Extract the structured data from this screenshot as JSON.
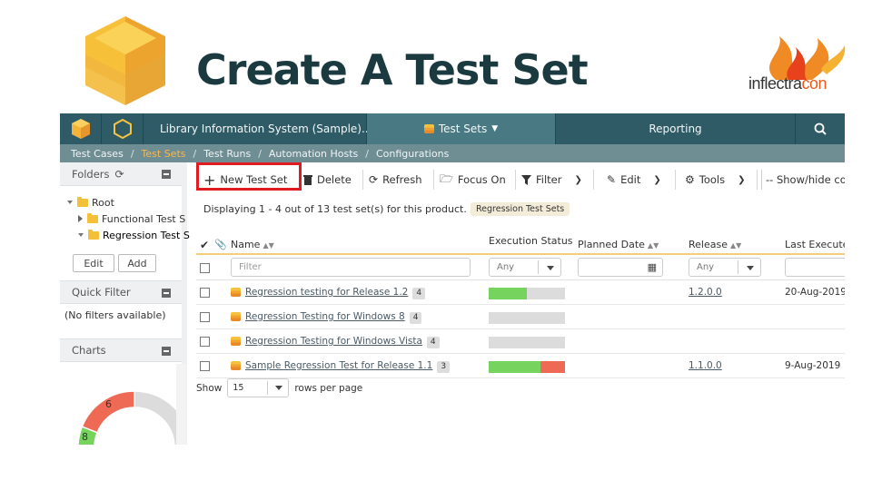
{
  "slide": {
    "title": "Create A Test Set",
    "brand_prefix": "inflectra",
    "brand_suffix": "con"
  },
  "topbar": {
    "project": "Library Information System (Sample)...",
    "artifact": "Test Sets",
    "reporting": "Reporting",
    "search_icon": "search-icon"
  },
  "subnav": {
    "items": [
      "Test Cases",
      "Test Sets",
      "Test Runs",
      "Automation Hosts",
      "Configurations"
    ],
    "active": "Test Sets"
  },
  "sidebar": {
    "folders_title": "Folders",
    "tree": {
      "root": "Root",
      "child1": "Functional Test S",
      "child2": "Regression Test S"
    },
    "edit_label": "Edit",
    "add_label": "Add",
    "quick_filter_title": "Quick Filter",
    "quick_filter_text": "(No filters available)",
    "charts_title": "Charts",
    "chart_data": {
      "type": "pie",
      "values": [
        6,
        8
      ],
      "labels": [
        "6",
        "8"
      ],
      "colors": [
        "#ef6a55",
        "#76d35e"
      ],
      "remainder_color": "#dcdcdc"
    }
  },
  "toolbar": {
    "new_label": "New Test Set",
    "delete_label": "Delete",
    "refresh_label": "Refresh",
    "focus_label": "Focus On",
    "filter_label": "Filter",
    "edit_label": "Edit",
    "tools_label": "Tools",
    "showhide_label": "-- Show/hide co"
  },
  "info": {
    "text": "Displaying 1 - 4 out of 13 test set(s) for this product.",
    "view_badge": "Regression Test Sets"
  },
  "grid": {
    "columns": {
      "name": "Name",
      "status": "Execution Status",
      "planned": "Planned Date",
      "release": "Release",
      "last": "Last Executed"
    },
    "filter": {
      "name_placeholder": "Filter",
      "status_value": "Any",
      "release_value": "Any"
    },
    "rows": [
      {
        "name": "Regression testing for Release 1.2",
        "count": "4",
        "pass": 0.5,
        "fail": 0.0,
        "release": "1.2.0.0",
        "last": "20-Aug-2019"
      },
      {
        "name": "Regression Testing for Windows 8",
        "count": "4",
        "pass": 0.0,
        "fail": 0.0,
        "release": "",
        "last": ""
      },
      {
        "name": "Regression Testing for Windows Vista",
        "count": "4",
        "pass": 0.0,
        "fail": 0.0,
        "release": "",
        "last": ""
      },
      {
        "name": "Sample Regression Test for Release 1.1",
        "count": "3",
        "pass": 0.68,
        "fail": 0.32,
        "release": "1.1.0.0",
        "last": "9-Aug-2019"
      }
    ],
    "pager": {
      "show": "Show",
      "per_page_value": "15",
      "rows_label": "rows per page"
    }
  }
}
